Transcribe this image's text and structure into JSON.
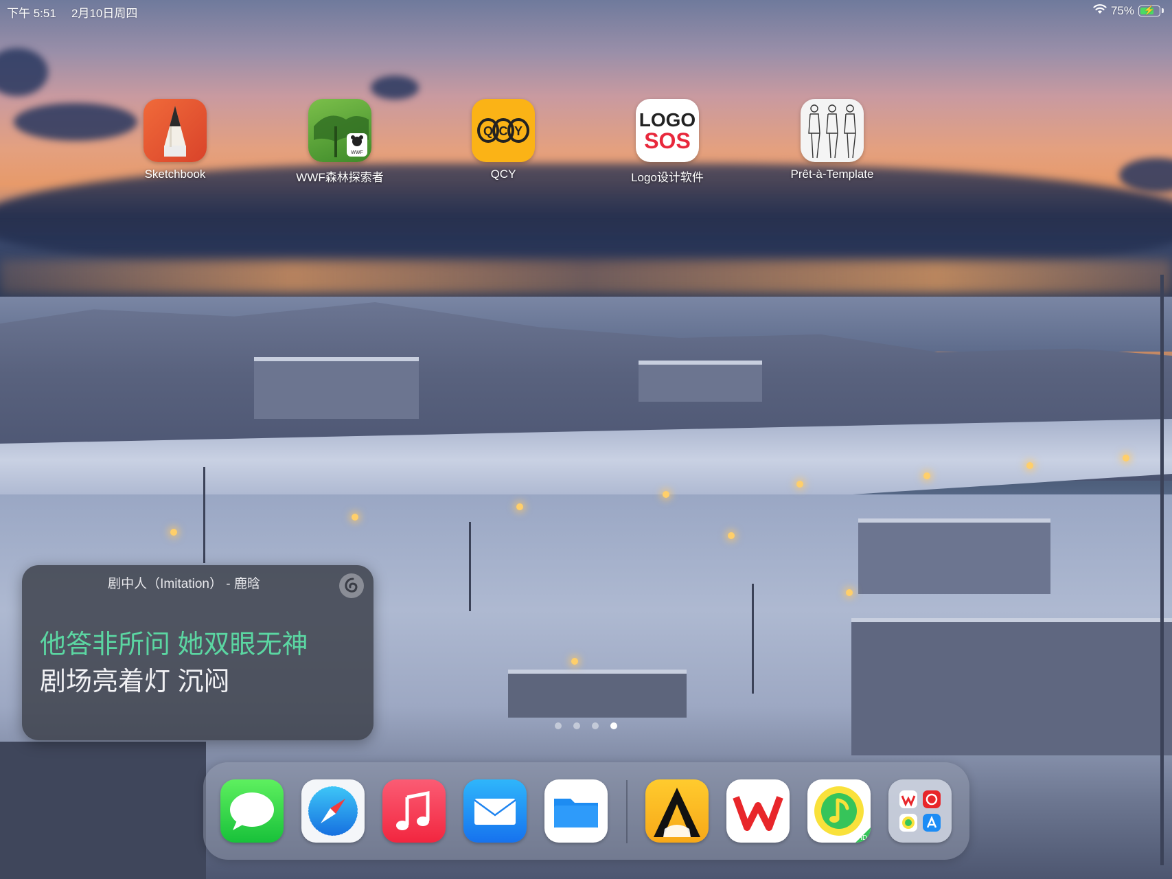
{
  "status_bar": {
    "time": "下午 5:51",
    "date": "2月10日周四",
    "battery_percent": "75%",
    "battery_level": 0.75,
    "wifi_icon": "wifi-icon",
    "charging_icon": "bolt-icon"
  },
  "home_apps": [
    {
      "label": "Sketchbook",
      "icon": "pencil-icon"
    },
    {
      "label": "WWF森林探索者",
      "icon": "wwf-panda-icon"
    },
    {
      "label": "QCY",
      "icon": "qcy-logo-icon",
      "icon_text": "QCY"
    },
    {
      "label": "Logo设计软件",
      "icon": "logo-sos-icon",
      "icon_text_top": "LOGO",
      "icon_text_bottom": "SOS"
    },
    {
      "label": "Prêt-à-Template",
      "icon": "fashion-figure-icon"
    }
  ],
  "lyrics_widget": {
    "song_title": "剧中人（Imitation） - 鹿晗",
    "current_line": "他答非所问 她双眼无神",
    "next_line": "剧场亮着灯 沉闷",
    "colors": {
      "current": "#5bd6a2",
      "next": "#f1f1f4"
    }
  },
  "page_dots": {
    "total": 4,
    "active": 4
  },
  "dock": {
    "apps": [
      {
        "name": "Messages",
        "icon": "messages-icon"
      },
      {
        "name": "Safari",
        "icon": "safari-compass-icon"
      },
      {
        "name": "Music",
        "icon": "music-note-icon"
      },
      {
        "name": "Mail",
        "icon": "mail-envelope-icon"
      },
      {
        "name": "Files",
        "icon": "files-folder-icon"
      }
    ],
    "recent_apps": [
      {
        "name": "Artstudio",
        "icon": "letter-a-icon"
      },
      {
        "name": "WPS Office",
        "icon": "wps-w-icon"
      },
      {
        "name": "QQ Music HD",
        "icon": "qq-music-icon",
        "badge": "HD"
      },
      {
        "name": "App Library",
        "icon": "app-library-icon"
      }
    ]
  }
}
